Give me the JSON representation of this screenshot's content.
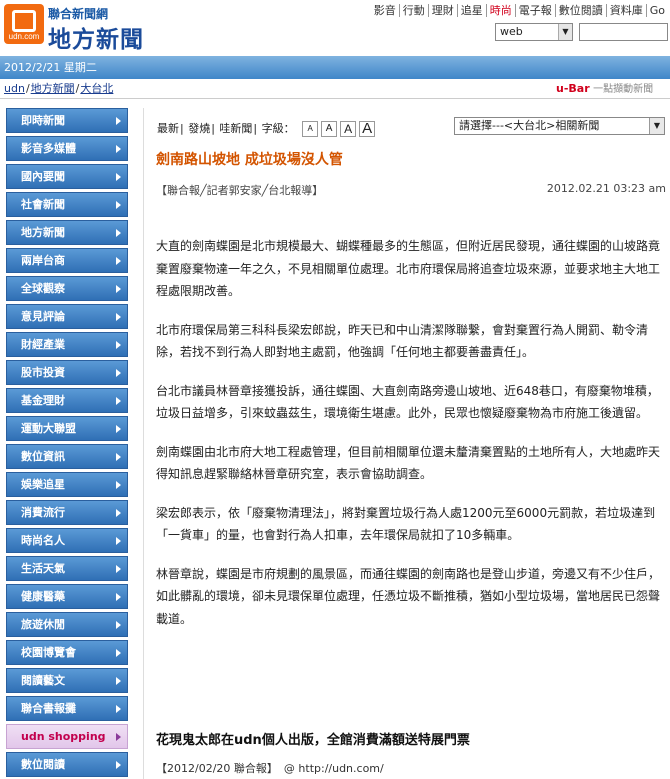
{
  "header": {
    "logo_top": "聯合新聞網",
    "logo_main": "地方新聞",
    "logo_small": "udn.com",
    "nav": [
      "影音",
      "行動",
      "理財",
      "追星",
      "時尚",
      "電子報",
      "數位閱讀",
      "資料庫",
      "Go"
    ],
    "search_select": "web"
  },
  "datebar": {
    "date": "2012/2/21 星期二"
  },
  "breadcrumb": [
    "udn",
    "地方新聞",
    "大台北"
  ],
  "ubar": {
    "brand": "u-Bar",
    "slogan": "一點擷動新聞"
  },
  "sidebar": {
    "items": [
      "即時新聞",
      "影音多媒體",
      "國內要聞",
      "社會新聞",
      "地方新聞",
      "兩岸台商",
      "全球觀察",
      "意見評論",
      "財經產業",
      "股市投資",
      "基金理財",
      "運動大聯盟",
      "數位資訊",
      "娛樂追星",
      "消費流行",
      "時尚名人",
      "生活天氣",
      "健康醫藥",
      "旅遊休閒",
      "校園博覽會",
      "閱讀藝文",
      "聯合書報攤",
      "udn shopping",
      "數位閱讀"
    ]
  },
  "toolbar": {
    "items": [
      "最新",
      "發燒",
      "哇新聞"
    ],
    "font_label": "字級：",
    "font_sizes": [
      "A",
      "A",
      "A",
      "A"
    ]
  },
  "related": {
    "label": "請選擇---<大台北>相關新聞"
  },
  "article": {
    "title": "劍南路山坡地 成垃圾場沒人管",
    "byline": "【聯合報╱記者郭安家╱台北報導】",
    "date": "2012.02.21 03:23 am",
    "paragraphs": [
      "大直的劍南蝶園是北市規模最大、蝴蝶種最多的生態區，但附近居民發現，通往蝶園的山坡路竟棄置廢棄物達一年之久，不見相關單位處理。北市府環保局將追查垃圾來源，並要求地主大地工程處限期改善。",
      "北市府環保局第三科科長梁宏郎說，昨天已和中山清潔隊聯繫，會對棄置行為人開罰、勒令清除，若找不到行為人即對地主處罰，他強調「任何地主都要善盡責任」。",
      "台北市議員林晉章接獲投訴，通往蝶園、大直劍南路旁邊山坡地、近648巷口，有廢棄物堆積，垃圾日益增多，引來蚊蟲茲生，環境衛生堪慮。此外，民眾也懷疑廢棄物為市府施工後遺留。",
      "劍南蝶園由北市府大地工程處管理，但目前相關單位還未釐清棄置點的土地所有人，大地處昨天得知訊息趕緊聯絡林晉章研究室，表示會協助調查。",
      "梁宏郎表示，依「廢棄物清理法」，將對棄置垃圾行為人處1200元至6000元罰款，若垃圾達到「一貨車」的量，也會對行為人扣車，去年環保局就扣了10多輛車。",
      "林晉章說，蝶園是市府規劃的風景區，而通往蝶園的劍南路也是登山步道，旁邊又有不少住戶，如此髒亂的環境，卻未見環保單位處理，任憑垃圾不斷推積，猶如小型垃圾場，當地居民已怨聲載道。"
    ],
    "promo": "花現鬼太郎在udn個人出版，全館消費滿額送特展門票",
    "source": "【2012/02/20 聯合報】",
    "source_url": "http://udn.com/"
  }
}
